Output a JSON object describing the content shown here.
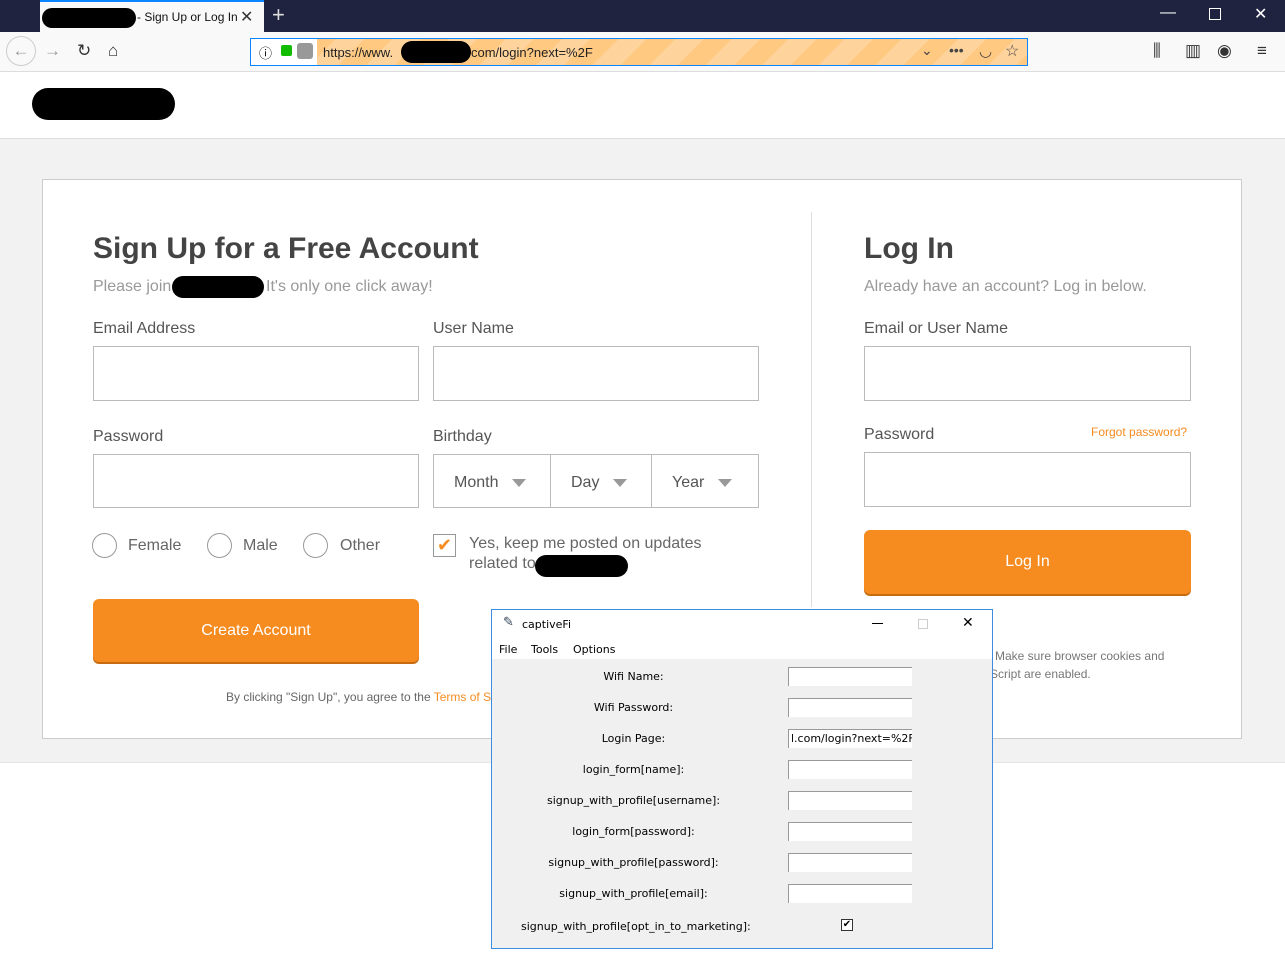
{
  "browser": {
    "tab_title": "- Sign Up or Log In",
    "url_visible": "https://www.",
    "url_suffix": "com/login?next=%2F"
  },
  "signup": {
    "title": "Sign Up for a Free Account",
    "subtitle_pre": "Please join",
    "subtitle_post": "It's only one click away!",
    "email_label": "Email Address",
    "username_label": "User Name",
    "password_label": "Password",
    "birthday_label": "Birthday",
    "month": "Month",
    "day": "Day",
    "year": "Year",
    "genders": [
      "Female",
      "Male",
      "Other"
    ],
    "optin_line1": "Yes, keep me posted on updates",
    "optin_line2": "related to",
    "optin_checked": true,
    "create_button": "Create Account",
    "terms_pre": "By clicking \"Sign Up\", you agree to the ",
    "terms_link": "Terms of S"
  },
  "login": {
    "title": "Log In",
    "subtitle": "Already have an account? Log in below.",
    "user_label": "Email or User Name",
    "password_label": "Password",
    "forgot": "Forgot password?",
    "button": "Log In",
    "note_line1": "Make sure browser cookies and",
    "note_line2": "Script are enabled."
  },
  "dialog": {
    "title": "captiveFi",
    "menu": [
      "File",
      "Tools",
      "Options"
    ],
    "fields": [
      {
        "label": "Wifi Name:",
        "value": ""
      },
      {
        "label": "Wifi Password:",
        "value": ""
      },
      {
        "label": "Login Page:",
        "value": "l.com/login?next=%2F"
      },
      {
        "label": "login_form[name]:",
        "value": ""
      },
      {
        "label": "signup_with_profile[username]:",
        "value": ""
      },
      {
        "label": "login_form[password]:",
        "value": ""
      },
      {
        "label": "signup_with_profile[password]:",
        "value": ""
      },
      {
        "label": "signup_with_profile[email]:",
        "value": ""
      }
    ],
    "checkbox_label": "signup_with_profile[opt_in_to_marketing]:",
    "checkbox_checked": true
  },
  "colors": {
    "accent": "#f68b1f",
    "tabbar": "#1f2340"
  }
}
